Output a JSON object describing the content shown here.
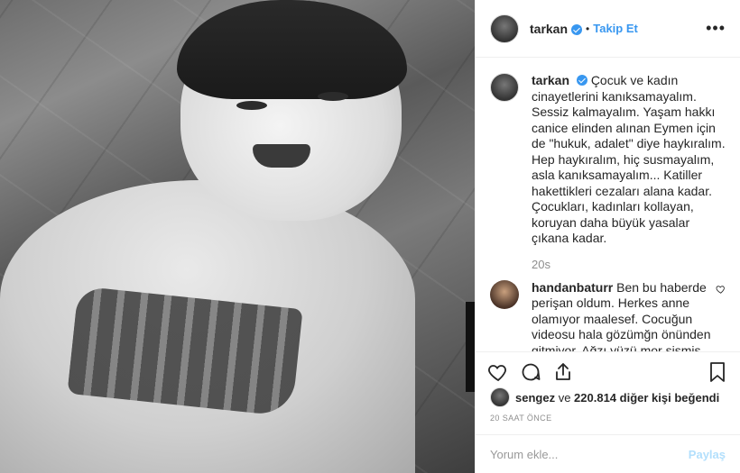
{
  "post": {
    "photo_alt": "black and white photo of a smiling child"
  },
  "header": {
    "username": "tarkan",
    "separator": "•",
    "follow_label": "Takip Et",
    "more_label": "•••"
  },
  "caption": {
    "username": "tarkan",
    "text": "Çocuk ve kadın cinayetlerini kanıksamayalım. Sessiz kalmayalım. Yaşam hakkı canice elinden alınan Eymen için de \"hukuk, adalet\" diye haykıralım. Hep haykıralım, hiç susmayalım, asla kanıksamayalım... Katiller hakettikleri cezaları alana kadar. Çocukları, kadınları kollayan, koruyan daha büyük yasalar çıkana kadar.",
    "time": "20s"
  },
  "comments": [
    {
      "username": "handanbaturr",
      "text": "Ben bu haberde perişan oldum. Herkes anne olamıyor maalesef. Cocuğun videosu hala gözümğn önünden gitmiyor. Ağzı yüzü mor şişmiş halde .\" Anne bak yemeğimi yedim anne kızma diyor korkulu titrek sesi"
    }
  ],
  "likes": {
    "user": "sengez",
    "connector": " ve ",
    "count": "220.814",
    "suffix": " diğer kişi beğendi"
  },
  "date": "20 SAAT ÖNCE",
  "add_comment": {
    "placeholder": "Yorum ekle...",
    "post_label": "Paylaş"
  },
  "colors": {
    "accent": "#3897f0",
    "post_disabled": "#b2dffc",
    "muted": "#8e8e8e"
  }
}
